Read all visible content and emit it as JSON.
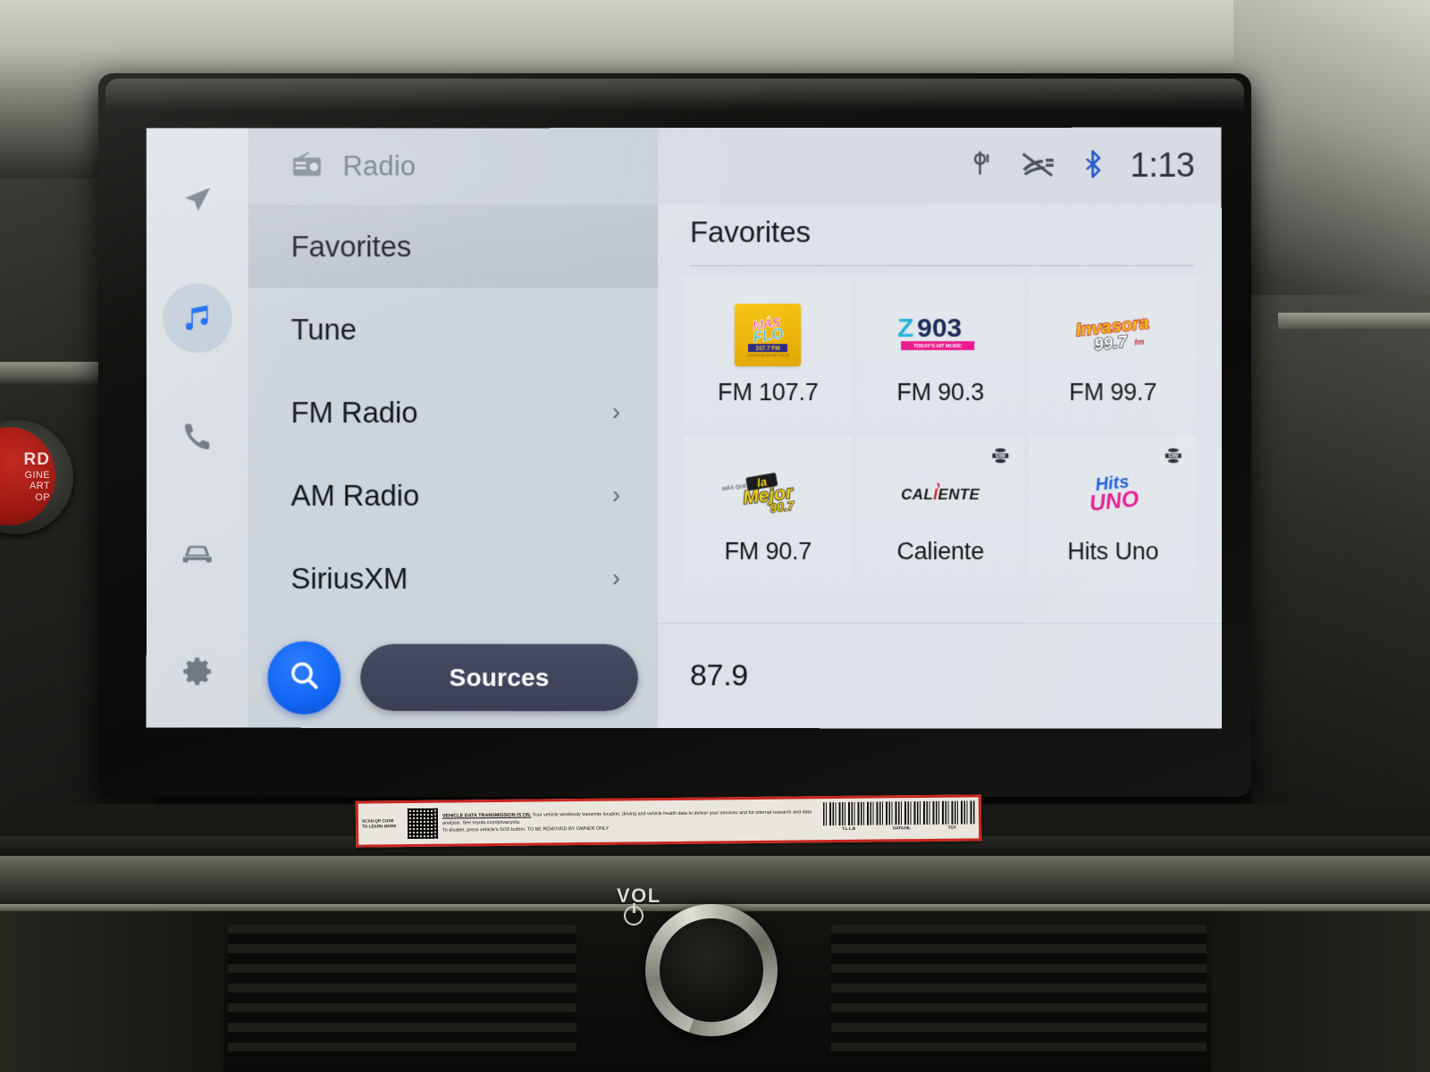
{
  "device": {
    "type": "toyota-infotainment-touchscreen",
    "hardware_labels": {
      "volume_knob": "VOL",
      "start_button_line1": "RD",
      "start_button_line2": "GINE",
      "start_button_line3": "ART",
      "start_button_line4": "OP"
    },
    "sticker": {
      "scan_text": "SCAN QR CODE\nTO LEARN MORE",
      "headline": "VEHICLE DATA TRANSMISSION IS ON.",
      "body": " Your vehicle wirelessly transmits location, driving and vehicle health data to deliver your services and for internal research and data analysis. See toyota.com/privacyvta.",
      "footer": "To disable, press vehicle's SOS button.   TO BE REMOVED BY OWNER ONLY",
      "barcode_labels": [
        "T.L.L.B",
        "DATA19L",
        "TOY"
      ]
    }
  },
  "rail": {
    "items": [
      {
        "name": "navigation",
        "icon": "navigation-arrow-icon",
        "active": false
      },
      {
        "name": "media",
        "icon": "music-note-icon",
        "active": true
      },
      {
        "name": "phone",
        "icon": "phone-icon",
        "active": false
      },
      {
        "name": "vehicle",
        "icon": "car-icon",
        "active": false
      },
      {
        "name": "settings",
        "icon": "gear-icon",
        "active": false
      }
    ]
  },
  "header": {
    "source_icon": "radio-icon",
    "title": "Radio"
  },
  "status": {
    "icons": [
      "wireless-charging-icon",
      "traffic-muted-icon",
      "bluetooth-icon"
    ],
    "time": "1:13"
  },
  "menu": {
    "items": [
      {
        "label": "Favorites",
        "chevron": false,
        "selected": true
      },
      {
        "label": "Tune",
        "chevron": false,
        "selected": false
      },
      {
        "label": "FM Radio",
        "chevron": true,
        "selected": false
      },
      {
        "label": "AM Radio",
        "chevron": true,
        "selected": false
      },
      {
        "label": "SiriusXM",
        "chevron": true,
        "selected": false
      }
    ],
    "chevron_glyph": "›"
  },
  "actions": {
    "search_label": "search-icon",
    "sources_label": "Sources"
  },
  "favorites": {
    "heading": "Favorites",
    "tiles": [
      {
        "label": "FM 107.7",
        "logo": "mas-flo-107-7-logo",
        "logo_text": "MÁS FLO",
        "logo_sub": "107.7 FM",
        "badge": null
      },
      {
        "label": "FM 90.3",
        "logo": "z903-logo",
        "logo_text": "Z903",
        "logo_sub": "TODAY'S HIT MUSIC",
        "badge": null
      },
      {
        "label": "FM 99.7",
        "logo": "invasora-99-7-logo",
        "logo_text": "Invasora",
        "logo_sub": "99.7 fm",
        "badge": null
      },
      {
        "label": "FM 90.7",
        "logo": "la-mejor-90-7-logo",
        "logo_text": "la Mejor",
        "logo_sub": "90.7",
        "badge": null
      },
      {
        "label": "Caliente",
        "logo": "caliente-logo",
        "logo_text": "CALIENTE",
        "logo_sub": "",
        "badge": "siriusxm-badge"
      },
      {
        "label": "Hits Uno",
        "logo": "hits-uno-logo",
        "logo_text": "Hits",
        "logo_sub": "UNO",
        "badge": "siriusxm-badge"
      }
    ]
  },
  "now_playing": {
    "frequency": "87.9"
  },
  "colors": {
    "screen_bg": "#d9dee2",
    "left_panel": "#cdd5dc",
    "right_panel": "#dde3e8",
    "accent_blue": "#1367f5",
    "sources_navy": "#3f4359",
    "text_primary": "#13171b",
    "text_muted": "#6b7681",
    "start_button_red": "#9e1812"
  }
}
